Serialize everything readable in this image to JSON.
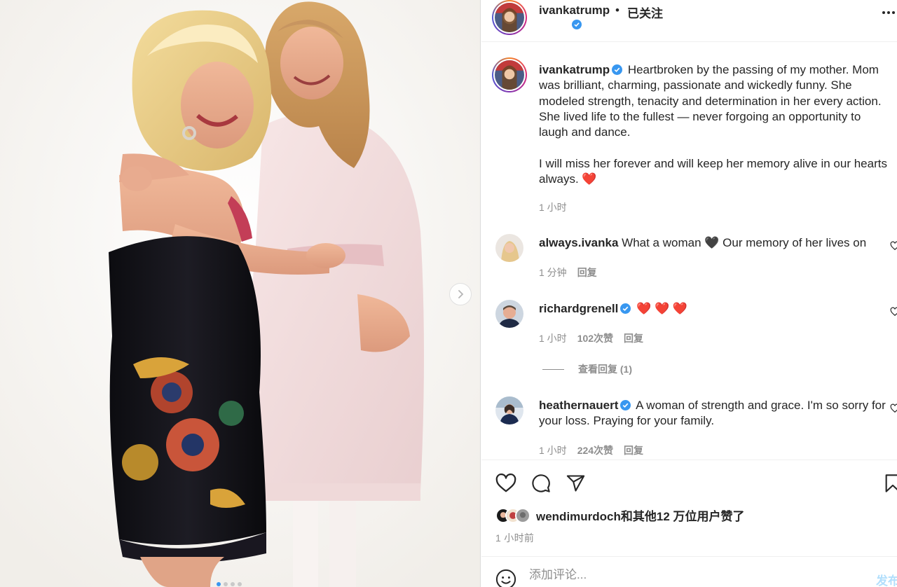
{
  "colors": {
    "accent": "#3897f0",
    "text": "#262626",
    "muted": "#8e8e8e",
    "heart": "#ed4956",
    "border": "#dbdbdb"
  },
  "photo": {
    "next_icon": "chevron-right-icon",
    "dots_count": 4,
    "active_dot": 0
  },
  "header": {
    "username": "ivankatrump",
    "separator": "•",
    "follow_status": "已关注",
    "verified_icon": "verified-badge-icon",
    "more_icon": "more-horizontal-icon"
  },
  "caption": {
    "username": "ivankatrump",
    "text_p1": "Heartbroken by the passing of my mother. Mom was brilliant, charming, passionate and wickedly funny. She modeled strength, tenacity and determination in her every action. She lived life to the fullest — never forgoing an opportunity to laugh and dance.",
    "text_p2": "I will miss her forever and will keep her memory alive in our hearts always. ❤️",
    "time": "1 小时"
  },
  "comments": [
    {
      "username": "always.ivanka",
      "text": "What a woman 🖤 Our memory of her lives on",
      "time": "1 分钟",
      "reply": "回复"
    },
    {
      "username": "richardgrenell",
      "text": "❤️ ❤️ ❤️",
      "time": "1 小时",
      "likes": "102次赞",
      "reply": "回复",
      "view_replies": "查看回复 (1)"
    },
    {
      "username": "heathernauert",
      "text": "A woman of strength and grace. I'm so sorry for your loss. Praying for your family.",
      "time": "1 小时",
      "likes": "224次赞",
      "reply": "回复"
    }
  ],
  "actions": {
    "like": "heart-icon",
    "comment": "comment-icon",
    "share": "share-icon",
    "save": "bookmark-icon"
  },
  "likes": {
    "text": "wendimurdoch和其他12 万位用户赞了"
  },
  "posted": "1 小时前",
  "add_comment": {
    "placeholder": "添加评论...",
    "post_label": "发布",
    "emoji_icon": "emoji-icon"
  }
}
